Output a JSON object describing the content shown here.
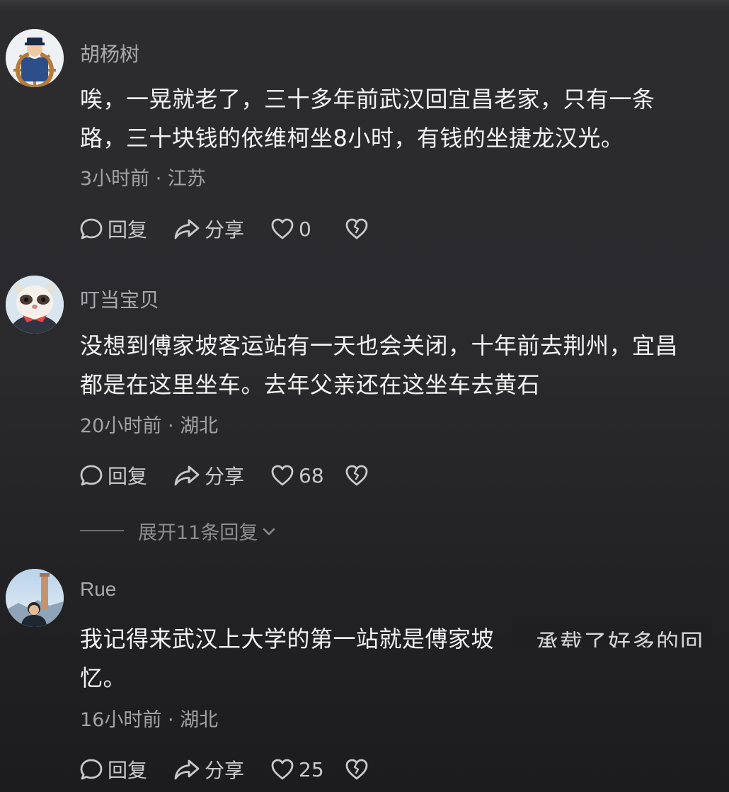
{
  "comments": [
    {
      "username": "胡杨树",
      "avatar_icon": "captain-helm-avatar",
      "lines": [
        "唉，一晃就老了，三十多年前武汉回宜昌老家，只有一条",
        "路，三十块钱的依维柯坐8小时，有钱的坐捷龙汉光。"
      ],
      "meta": "3小时前 · 江苏",
      "reply_label": "回复",
      "share_label": "分享",
      "like_count": "0"
    },
    {
      "username": "叮当宝贝",
      "avatar_icon": "ferret-avatar",
      "lines": [
        "没想到傅家坡客运站有一天也会关闭，十年前去荆州，宜昌",
        "都是在这里坐车。去年父亲还在这坐车去黄石"
      ],
      "meta": "20小时前 · 湖北",
      "reply_label": "回复",
      "share_label": "分享",
      "like_count": "68",
      "expand_label": "展开11条回复"
    },
    {
      "username": "Rue",
      "avatar_icon": "tower-photo-avatar",
      "lines": [
        "我记得来武汉上大学的第一站就是傅家坡",
        "忆。"
      ],
      "cut_text": "承载了好多的回",
      "meta": "16小时前 · 湖北",
      "reply_label": "回复",
      "share_label": "分享",
      "like_count": "25"
    }
  ],
  "colors": {
    "background": "#2a2a2d",
    "text": "#f3f3f3",
    "muted": "#a3a3a7",
    "action": "#c9c9cc"
  }
}
